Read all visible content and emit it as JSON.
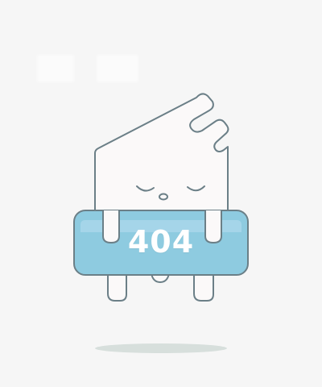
{
  "page": {
    "error_code": "404"
  },
  "colors": {
    "background": "#f6f6f6",
    "outline": "#6b7f87",
    "ghost_fill": "#fbf9f9",
    "sign_fill": "#8ecbe0",
    "sign_highlight": "#b8dff0",
    "shadow": "#d7dfdc"
  },
  "icons": {
    "character": "sleeping-ghost-icon",
    "sign": "error-sign-icon"
  }
}
